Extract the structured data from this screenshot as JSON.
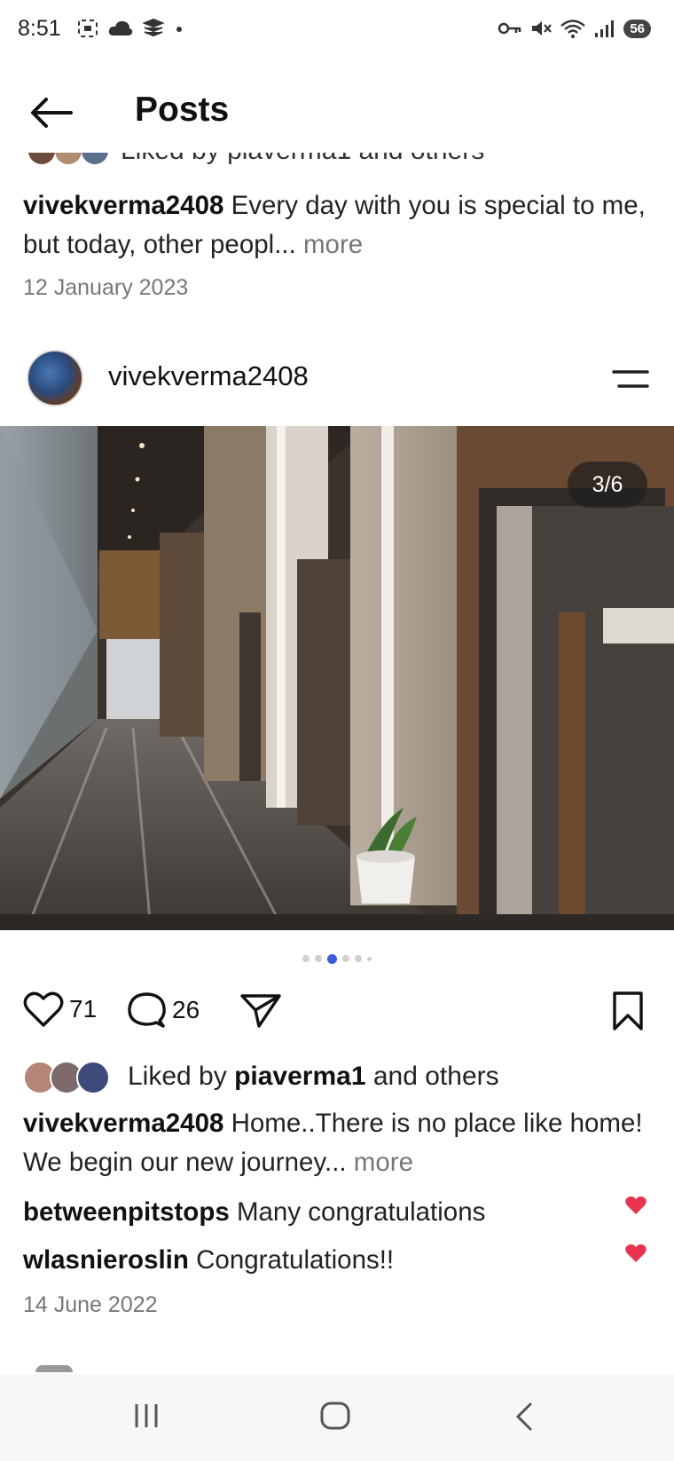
{
  "status_bar": {
    "time": "8:51",
    "battery": "56",
    "left_icons": [
      "screenshot-icon",
      "cloud-icon",
      "stack-icon",
      "dot-icon"
    ],
    "right_icons": [
      "key-icon",
      "mute-icon",
      "wifi-icon",
      "signal-icon"
    ]
  },
  "header": {
    "title": "Posts"
  },
  "previous_post": {
    "likes_text": "Liked by piaverma1 and others",
    "caption_user": "vivekverma2408",
    "caption_text": " Every day with you is special to me, but today, other peopl...",
    "more_label": " more",
    "date": "12 January 2023"
  },
  "post": {
    "username": "vivekverma2408",
    "image_counter": "3/6",
    "carousel_total": 6,
    "carousel_active": 3,
    "likes_count": "71",
    "comments_count": "26",
    "liked_by_prefix": "Liked by ",
    "liked_by_user": "piaverma1",
    "liked_by_suffix": " and others",
    "caption_user": "vivekverma2408",
    "caption_text": " Home..There is no place like home! We begin our new journey...",
    "more_label": " more",
    "comments": [
      {
        "user": "betweenpitstops",
        "text": " Many congratulations"
      },
      {
        "user": "wlasnieroslin",
        "text": " Congratulations!!"
      }
    ],
    "date": "14 June 2022"
  },
  "colors": {
    "accent_dot": "#3b5bdb",
    "heart_red": "#e8344e"
  }
}
